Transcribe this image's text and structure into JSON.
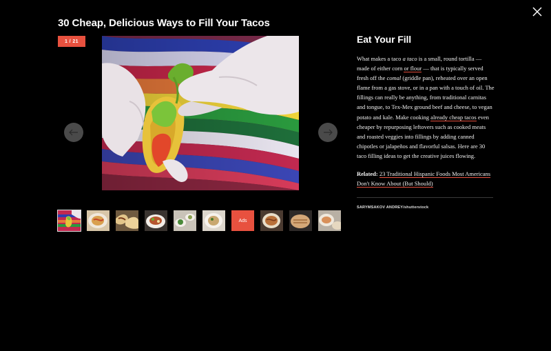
{
  "header": {
    "title": "30 Cheap, Delicious Ways to Fill Your Tacos",
    "close_icon": "close-icon"
  },
  "gallery": {
    "counter": "1 / 21",
    "prev_icon": "arrow-left-icon",
    "next_icon": "arrow-right-icon",
    "main_image_alt": "Gloved hands holding a small taco filled with lettuce and salsa in front of a striped serape",
    "thumbnails": [
      {
        "kind": "image",
        "active": true,
        "icon": "taco-thumb"
      },
      {
        "kind": "image",
        "icon": "pasta-thumb"
      },
      {
        "kind": "image",
        "icon": "tacos-thumb"
      },
      {
        "kind": "image",
        "icon": "salad-plate-thumb"
      },
      {
        "kind": "image",
        "icon": "table-thumb"
      },
      {
        "kind": "image",
        "icon": "bowl-thumb"
      },
      {
        "kind": "ads",
        "label": "Ads"
      },
      {
        "kind": "image",
        "icon": "bowl-thumb-2"
      },
      {
        "kind": "image",
        "icon": "bread-thumb"
      },
      {
        "kind": "image",
        "icon": "dish-thumb"
      }
    ]
  },
  "article": {
    "heading": "Eat Your Fill",
    "p1": "What makes a taco ",
    "p1_em": "a taco",
    "p2": " is a small, round tortilla — made of either corn ",
    "p2_link": "or flour",
    "p3": " — that is typically served fresh off the ",
    "p3_em": "comal",
    "p4": " (griddle pan), reheated over an open flame from a gas stove, or in a pan with a touch of oil. The fillings can really be anything, from traditional carnitas and tongue, to Tex-Mex ground beef and cheese, to vegan potato and kale. Make cooking ",
    "p4_link": "already cheap tacos",
    "p5": " even cheaper by repurposing leftovers such as cooked meats and roasted veggies into fillings by adding canned chipotles or jalapeños and flavorful salsas. Here are 30 taco filling ideas to get the creative juices flowing.",
    "related_label": "Related:",
    "related_link": "23 Traditional Hispanic Foods Most Americans Don't Know About (But Should)",
    "credit": "SARYMSAKOV ANDREY/shutterstock"
  },
  "colors": {
    "accent": "#e8513f",
    "background": "#000000"
  }
}
